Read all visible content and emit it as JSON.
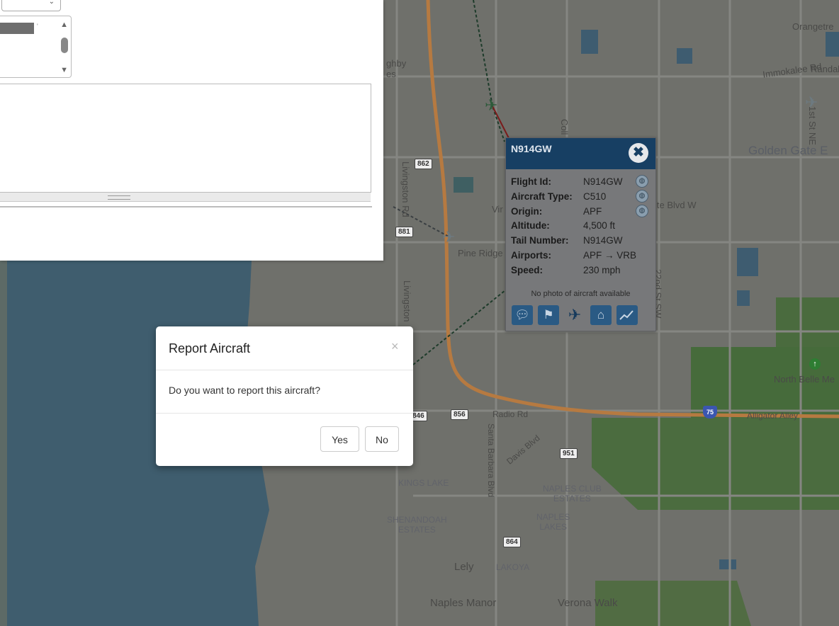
{
  "map": {
    "labels": {
      "orangetree": "Orangetre",
      "immokalee_rd": "Immokalee Rd",
      "randal": "Randal",
      "golden_gate": "Golden Gate E",
      "willoughby": "ghby\nes",
      "livingston_rd_1": "Livingston Rd",
      "livingston_rd_2": "Livingston",
      "pine_ridge": "Pine Ridge",
      "vir": "Vir",
      "white_blvd": "ite Blvd W",
      "collier": "Coll",
      "twentysecond_st": "22nd St SW",
      "first_st_ne": "1st St NE",
      "north_belle": "North Belle Me",
      "alligator_alley": "Alligator Alley",
      "radio_rd": "Radio Rd",
      "santa_barbara": "Santa Barbara Blvd",
      "davis_blvd": "Davis Blvd",
      "kings_lake": "KINGS LAKE",
      "naples_club": "NAPLES CLUB\nESTATES",
      "naples_lakes": "NAPLES\nLAKES",
      "shenandoah": "SHENANDOAH\nESTATES",
      "lely": "Lely",
      "lakoya": "LAKOYA",
      "naples_manor": "Naples Manor",
      "verona_walk": "Verona Walk"
    },
    "shields": {
      "s862": "862",
      "s881": "881",
      "s856": "856",
      "s951": "951",
      "s864": "864",
      "s846": "846",
      "i75": "75"
    }
  },
  "side_panel": {
    "select_icon": "map-layer-icon"
  },
  "aircraft_popup": {
    "title": "N914GW",
    "close_icon": "close-circle-icon",
    "rows": [
      {
        "key": "Flight Id:",
        "value": "N914GW"
      },
      {
        "key": "Aircraft Type:",
        "value": "C510"
      },
      {
        "key": "Origin:",
        "value": "APF"
      },
      {
        "key": "Altitude:",
        "value": "4,500 ft"
      },
      {
        "key": "Tail Number:",
        "value": "N914GW"
      },
      {
        "key": "Airports:",
        "value": "APF → VRB"
      },
      {
        "key": "Speed:",
        "value": "230 mph"
      }
    ],
    "no_photo": "No photo of aircraft available",
    "actions": [
      "comment-icon",
      "flag-icon",
      "plane-icon",
      "home-icon",
      "chart-icon"
    ]
  },
  "report_modal": {
    "title": "Report Aircraft",
    "close_glyph": "×",
    "message": "Do you want to report this aircraft?",
    "yes_label": "Yes",
    "no_label": "No"
  }
}
